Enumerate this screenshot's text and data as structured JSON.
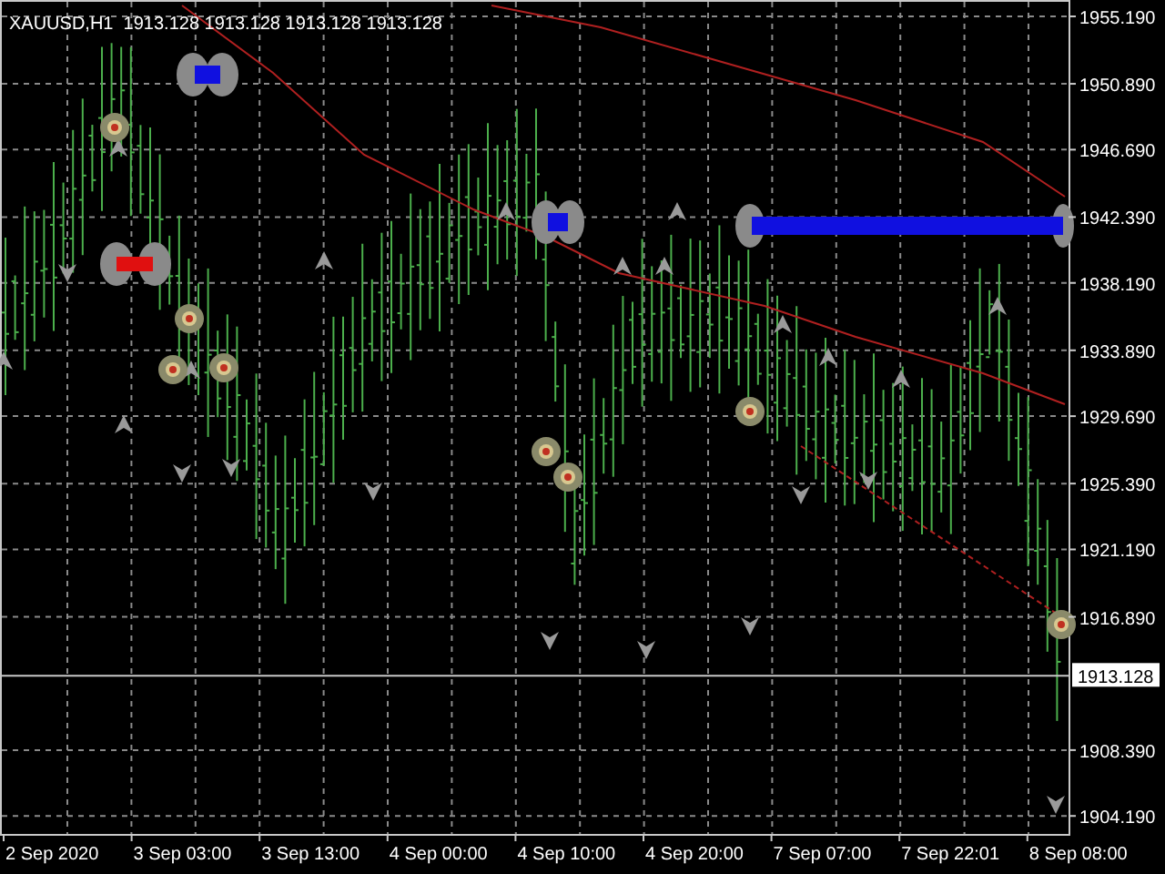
{
  "chart_title": "XAUUSD,H1  1913.128 1913.128 1913.128 1913.128",
  "price_axis": [
    "1955.190",
    "1950.890",
    "1946.690",
    "1942.390",
    "1938.190",
    "1933.890",
    "1929.690",
    "1925.390",
    "1921.190",
    "1916.890",
    "1908.390",
    "1904.190"
  ],
  "current_price": "1913.128",
  "time_axis": [
    "2 Sep 2020",
    "3 Sep 03:00",
    "3 Sep 13:00",
    "4 Sep 00:00",
    "4 Sep 10:00",
    "4 Sep 20:00",
    "7 Sep 07:00",
    "7 Sep 22:01",
    "8 Sep 08:00"
  ]
}
